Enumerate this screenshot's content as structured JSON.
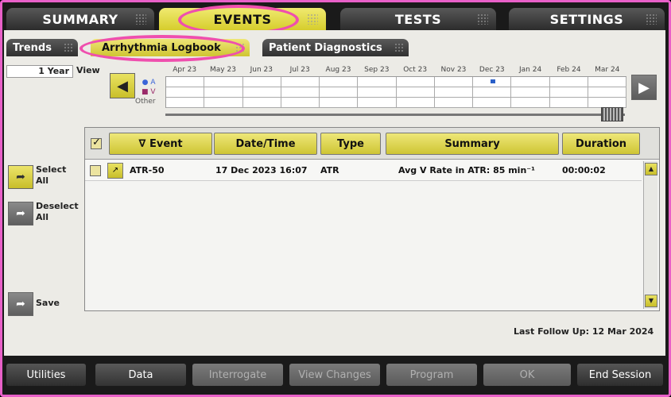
{
  "top_tabs": [
    {
      "label": "SUMMARY"
    },
    {
      "label": "EVENTS"
    },
    {
      "label": "TESTS"
    },
    {
      "label": "SETTINGS"
    }
  ],
  "sub_tabs": [
    {
      "label": "Trends"
    },
    {
      "label": "Arrhythmia Logbook"
    },
    {
      "label": "Patient Diagnostics"
    }
  ],
  "timeline": {
    "range_value": "1 Year",
    "view_label": "View",
    "months": [
      "Apr 23",
      "May 23",
      "Jun 23",
      "Jul 23",
      "Aug 23",
      "Sep 23",
      "Oct 23",
      "Nov 23",
      "Dec 23",
      "Jan 24",
      "Feb 24",
      "Mar 24"
    ],
    "legend": {
      "a": "A",
      "v": "V",
      "other": "Other"
    },
    "dot_a": "●",
    "dot_v": "■"
  },
  "table": {
    "headers": {
      "event": "∇ Event",
      "datetime": "Date/Time",
      "type": "Type",
      "summary": "Summary",
      "duration": "Duration"
    },
    "rows": [
      {
        "event": "ATR-50",
        "datetime": "17 Dec 2023 16:07",
        "type": "ATR",
        "summary": "Avg V Rate in ATR: 85 min⁻¹",
        "duration": "00:00:02"
      }
    ]
  },
  "side": {
    "select_all": "Select\nAll",
    "deselect_all": "Deselect\nAll",
    "save": "Save"
  },
  "follow_up": "Last Follow Up: 12 Mar 2024",
  "bottom_bar": {
    "utilities": "Utilities",
    "data": "Data",
    "interrogate": "Interrogate",
    "view_changes": "View Changes",
    "program": "Program",
    "ok": "OK",
    "end_session": "End Session"
  },
  "colors": {
    "accent": "#d9d030",
    "highlight": "#ef4fae",
    "frame": "#e860c8"
  },
  "icons": {
    "nav_left": "triangle-left-icon",
    "nav_right": "triangle-right-icon",
    "arrow": "curved-arrow-icon"
  }
}
